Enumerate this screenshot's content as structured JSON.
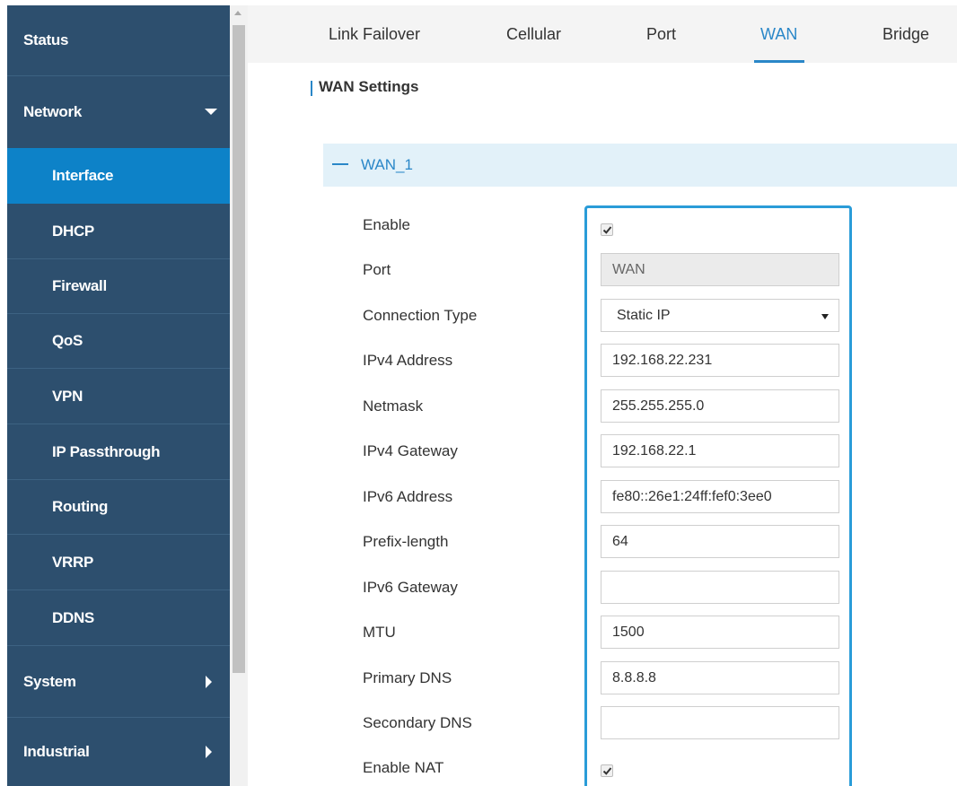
{
  "sidebar": {
    "status": "Status",
    "network": "Network",
    "network_items": [
      "Interface",
      "DHCP",
      "Firewall",
      "QoS",
      "VPN",
      "IP Passthrough",
      "Routing",
      "VRRP",
      "DDNS"
    ],
    "system": "System",
    "industrial": "Industrial"
  },
  "tabs": [
    "Link Failover",
    "Cellular",
    "Port",
    "WAN",
    "Bridge"
  ],
  "active_tab": "WAN",
  "section_title": "WAN Settings",
  "wan_group": {
    "title": "WAN_1"
  },
  "form": {
    "enable": {
      "label": "Enable",
      "checked": true
    },
    "port": {
      "label": "Port",
      "value": "WAN"
    },
    "connection_type": {
      "label": "Connection Type",
      "value": "Static IP"
    },
    "ipv4_address": {
      "label": "IPv4 Address",
      "value": "192.168.22.231"
    },
    "netmask": {
      "label": "Netmask",
      "value": "255.255.255.0"
    },
    "ipv4_gateway": {
      "label": "IPv4 Gateway",
      "value": "192.168.22.1"
    },
    "ipv6_address": {
      "label": "IPv6 Address",
      "value": "fe80::26e1:24ff:fef0:3ee0"
    },
    "prefix_length": {
      "label": "Prefix-length",
      "value": "64"
    },
    "ipv6_gateway": {
      "label": "IPv6 Gateway",
      "value": ""
    },
    "mtu": {
      "label": "MTU",
      "value": "1500"
    },
    "primary_dns": {
      "label": "Primary DNS",
      "value": "8.8.8.8"
    },
    "secondary_dns": {
      "label": "Secondary DNS",
      "value": ""
    },
    "enable_nat": {
      "label": "Enable NAT",
      "checked": true
    }
  },
  "colors": {
    "sidebar_bg": "#2d4f6e",
    "sidebar_active": "#0d82c8",
    "accent": "#2a87c8",
    "highlight_border": "#2a9cd8"
  }
}
